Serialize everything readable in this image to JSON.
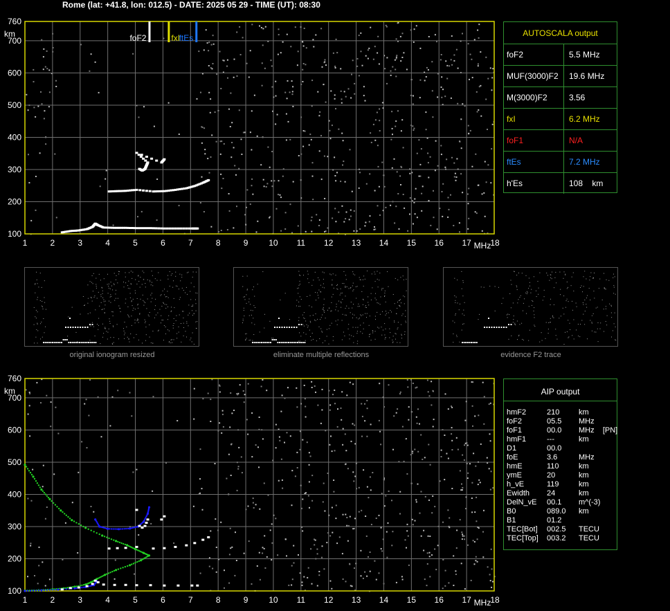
{
  "header": {
    "title": "Rome (lat: +41.8, lon: 012.5) - DATE: 2025 05 29 - TIME (UT): 08:30"
  },
  "colors": {
    "grid": "#707070",
    "frame": "#d8d800",
    "text": "#ffffff",
    "foF2_marker": "#ffffff",
    "fxI_marker": "#e0e000",
    "ftEs_marker": "#1e78ff",
    "profile": "#22d022",
    "aip_trace": "#1a1aff",
    "panel_border": "#2f8f2f",
    "autoscala_title": "#e8e000",
    "fof1_color": "#ff2020",
    "ftes_color": "#2a8cff"
  },
  "axes": {
    "x_ticks": [
      "1",
      "2",
      "3",
      "4",
      "5",
      "6",
      "7",
      "8",
      "9",
      "10",
      "11",
      "12",
      "13",
      "14",
      "15",
      "16",
      "17",
      "18"
    ],
    "x_unit": "MHz",
    "y_ticks": [
      "100",
      "200",
      "300",
      "400",
      "500",
      "600",
      "700",
      "760"
    ],
    "y_unit": "km"
  },
  "markers": [
    {
      "label": "foF2",
      "freq": 5.5
    },
    {
      "label": "fxI",
      "freq": 6.2
    },
    {
      "label": "ftEs",
      "freq": 7.2
    }
  ],
  "autoscala": {
    "title": "AUTOSCALA output",
    "rows": [
      {
        "key": "foF2",
        "value": "5.5 MHz",
        "color": "#ffffff"
      },
      {
        "key": "MUF(3000)F2",
        "value": "19.6 MHz",
        "color": "#ffffff"
      },
      {
        "key": "M(3000)F2",
        "value": "3.56",
        "color": "#ffffff"
      },
      {
        "key": "fxI",
        "value": "6.2 MHz",
        "color": "#e8e000"
      },
      {
        "key": "foF1",
        "value": "N/A",
        "color": "#ff2020"
      },
      {
        "key": "ftEs",
        "value": "7.2 MHz",
        "color": "#2a8cff"
      },
      {
        "key": "h'Es",
        "value": "108    km",
        "color": "#ffffff"
      }
    ]
  },
  "thumbnails": [
    {
      "caption": "original ionogram resized"
    },
    {
      "caption": "eliminate multiple reflections"
    },
    {
      "caption": "evidence F2 trace"
    }
  ],
  "aip": {
    "title": "AIP output",
    "rows": [
      {
        "k": "hmF2",
        "v": "210",
        "u": "km"
      },
      {
        "k": "foF2",
        "v": "05.5",
        "u": "MHz"
      },
      {
        "k": "foF1",
        "v": "00.0",
        "u": "MHz    [PN]"
      },
      {
        "k": "hmF1",
        "v": "---",
        "u": "km"
      },
      {
        "k": "D1",
        "v": "00.0",
        "u": ""
      },
      {
        "k": "foE",
        "v": "3.6",
        "u": "MHz"
      },
      {
        "k": "hmE",
        "v": "110",
        "u": "km"
      },
      {
        "k": "ymE",
        "v": "20",
        "u": "km"
      },
      {
        "k": "h_vE",
        "v": "119",
        "u": "km"
      },
      {
        "k": "Ewidth",
        "v": "24",
        "u": "km"
      },
      {
        "k": "DelN_vE",
        "v": "00.1",
        "u": "m^(-3)"
      },
      {
        "k": "B0",
        "v": "089.0",
        "u": "km"
      },
      {
        "k": "B1",
        "v": "01.2",
        "u": ""
      },
      {
        "k": "TEC[Bot]",
        "v": "002.5",
        "u": "TECU"
      },
      {
        "k": "TEC[Top]",
        "v": "003.2",
        "u": "TECU"
      }
    ]
  },
  "chart_data": [
    {
      "type": "scatter",
      "xlim": [
        1,
        18
      ],
      "ylim": [
        100,
        760
      ],
      "series": [
        {
          "values": [
            [
              2.3,
              108
            ],
            [
              2.6,
              112
            ],
            [
              2.9,
              114
            ],
            [
              3.2,
              118
            ],
            [
              3.4,
              125
            ],
            [
              3.5,
              135
            ],
            [
              3.6,
              130
            ],
            [
              3.8,
              123
            ],
            [
              4.2,
              122
            ],
            [
              4.6,
              122
            ],
            [
              5.0,
              121
            ],
            [
              5.5,
              121
            ],
            [
              6.0,
              120
            ],
            [
              6.5,
              120
            ],
            [
              7.0,
              120
            ],
            [
              7.2,
              120
            ]
          ]
        },
        {
          "values": [
            [
              4.0,
              235
            ],
            [
              4.3,
              236
            ],
            [
              4.6,
              237
            ],
            [
              5.0,
              240
            ],
            [
              5.6,
              235
            ],
            [
              6.0,
              236
            ],
            [
              6.4,
              240
            ],
            [
              6.8,
              245
            ],
            [
              7.1,
              252
            ],
            [
              7.4,
              262
            ],
            [
              7.6,
              270
            ]
          ]
        },
        {
          "values": [
            [
              5.1,
              305
            ],
            [
              5.2,
              300
            ],
            [
              5.3,
              305
            ],
            [
              5.35,
              315
            ],
            [
              5.4,
              325
            ],
            [
              5.0,
              355
            ],
            [
              5.9,
              325
            ],
            [
              6.0,
              335
            ]
          ]
        }
      ]
    },
    {
      "type": "line",
      "xlim": [
        1,
        18
      ],
      "ylim": [
        100,
        760
      ],
      "series": [
        {
          "values": [
            [
              1.0,
              492
            ],
            [
              1.3,
              455
            ],
            [
              1.6,
              415
            ],
            [
              1.9,
              385
            ],
            [
              2.3,
              350
            ],
            [
              2.7,
              320
            ],
            [
              3.2,
              296
            ],
            [
              3.8,
              272
            ],
            [
              4.3,
              255
            ],
            [
              4.7,
              242
            ],
            [
              5.0,
              230
            ],
            [
              5.3,
              218
            ],
            [
              5.5,
              210
            ],
            [
              5.2,
              195
            ],
            [
              4.8,
              180
            ],
            [
              4.3,
              165
            ],
            [
              3.9,
              150
            ],
            [
              3.6,
              137
            ],
            [
              3.4,
              127
            ],
            [
              3.2,
              120
            ],
            [
              2.8,
              113
            ],
            [
              2.4,
              108
            ],
            [
              2.0,
              105
            ],
            [
              1.5,
              102
            ],
            [
              1.0,
              101
            ]
          ]
        },
        {
          "values": [
            [
              1.0,
              100
            ],
            [
              1.6,
              102
            ],
            [
              2.2,
              104
            ],
            [
              2.8,
              108
            ],
            [
              3.2,
              112
            ],
            [
              3.5,
              118
            ],
            [
              3.6,
              130
            ],
            [
              3.55,
              322
            ],
            [
              3.7,
              300
            ],
            [
              4.0,
              293
            ],
            [
              4.4,
              292
            ],
            [
              4.8,
              294
            ],
            [
              5.1,
              300
            ],
            [
              5.3,
              315
            ],
            [
              5.45,
              340
            ],
            [
              5.5,
              360
            ]
          ]
        }
      ]
    }
  ]
}
